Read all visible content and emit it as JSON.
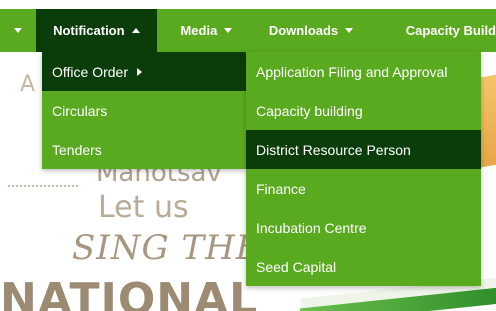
{
  "nav": {
    "items": [
      {
        "label": "Notification"
      },
      {
        "label": "Media"
      },
      {
        "label": "Downloads"
      },
      {
        "label": "Capacity Build"
      }
    ],
    "active_index": 0
  },
  "notification_menu": {
    "items": [
      {
        "label": "Office Order"
      },
      {
        "label": "Circulars"
      },
      {
        "label": "Tenders"
      }
    ]
  },
  "office_order_submenu": {
    "items": [
      {
        "label": "Application Filing and Approval"
      },
      {
        "label": "Capacity building"
      },
      {
        "label": "District Resource Person"
      },
      {
        "label": "Finance"
      },
      {
        "label": "Incubation Centre"
      },
      {
        "label": "Seed Capital"
      }
    ],
    "highlighted_index": 2
  },
  "banner": {
    "line_a": "A",
    "line_mahotsav": "Mahotsav",
    "line_letus": "Let us",
    "line_sing": "SING THE",
    "line_national": "NATIONAL"
  },
  "colors": {
    "nav_green": "#5aaa1f",
    "active_dark": "#0b3d0b",
    "text": "#ffffff"
  }
}
